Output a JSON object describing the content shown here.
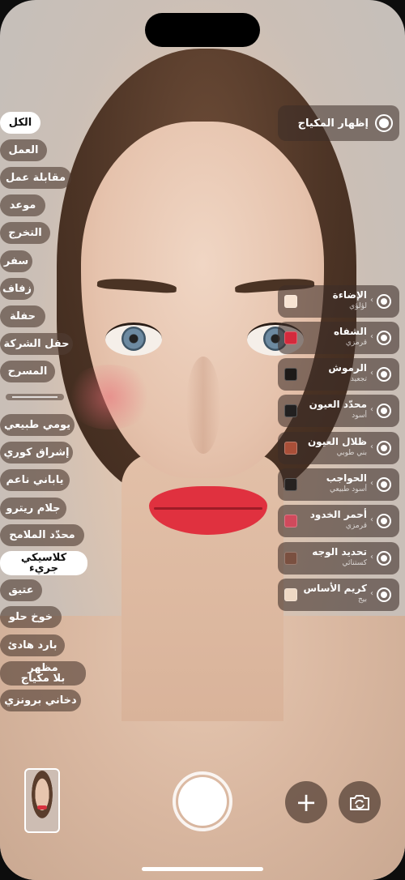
{
  "occasion_chips": [
    {
      "label": "الكل",
      "selected": true
    },
    {
      "label": "العمل"
    },
    {
      "label": "مقابلة عمل"
    },
    {
      "label": "موعد"
    },
    {
      "label": "التخرج"
    },
    {
      "label": "سفر"
    },
    {
      "label": "زفاف"
    },
    {
      "label": "حفلة"
    },
    {
      "label": "حفل الشركة"
    },
    {
      "label": "المسرح"
    }
  ],
  "style_chips": [
    {
      "label": "يومي طبيعي"
    },
    {
      "label": "إشراق كوري"
    },
    {
      "label": "ياباني ناعم"
    },
    {
      "label": "جلام ريترو"
    },
    {
      "label": "محدّد الملامح"
    },
    {
      "line1": "كلاسيكي",
      "line2": "جريء",
      "selected": true
    },
    {
      "label": "عتيق"
    },
    {
      "label": "خوخ حلو"
    },
    {
      "label": "بارد هادئ"
    },
    {
      "line1": "مظهر",
      "line2": "بلا مكياج"
    },
    {
      "label": "دخاني برونزي"
    }
  ],
  "show_makeup": {
    "label": "إظهار المكياج",
    "on": true
  },
  "makeup_items": [
    {
      "name": "الإضاءة",
      "shade": "لؤلؤي",
      "color": "#f7e3d2"
    },
    {
      "name": "الشفاه",
      "shade": "قرمزي",
      "color": "#d42a3c"
    },
    {
      "name": "الرموش",
      "shade": "تجعيد",
      "color": "#1e1a18"
    },
    {
      "name": "محدّد العيون",
      "shade": "أسود",
      "color": "#222020"
    },
    {
      "name": "ظلال العيون",
      "shade": "بني طوبي",
      "color": "#a94f38"
    },
    {
      "name": "الحواجب",
      "shade": "أسود طبيعي",
      "color": "#262220"
    },
    {
      "name": "أحمر الخدود",
      "shade": "قرمزي",
      "color": "#d04a5c"
    },
    {
      "name": "تحديد الوجه",
      "shade": "كستنائي",
      "color": "#7a5040"
    },
    {
      "name": "كريم الأساس",
      "shade": "بيج",
      "color": "#eed8c4"
    }
  ],
  "controls": {
    "add_symbol": "+"
  }
}
